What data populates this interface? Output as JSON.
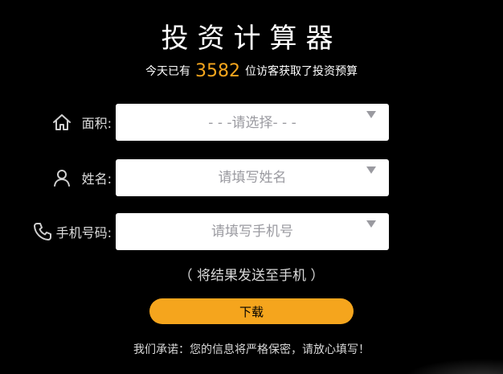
{
  "title": "投资计算器",
  "subtitle": {
    "prefix": "今天已有",
    "count": "3582",
    "suffix": "位访客获取了投资预算"
  },
  "form": {
    "area": {
      "icon": "home-icon",
      "label": "面积:",
      "selected": "- - -请选择- - -"
    },
    "name": {
      "icon": "user-icon",
      "label": "姓名:",
      "placeholder": "请填写姓名"
    },
    "phone": {
      "icon": "phone-icon",
      "label": "手机号码:",
      "placeholder": "请填写手机号"
    }
  },
  "hint": "（ 将结果发送至手机 ）",
  "download_label": "下载",
  "promise": "我们承诺：您的信息将严格保密，请放心填写！",
  "colors": {
    "background": "#000000",
    "accent": "#F5A51D",
    "field_background": "#FFFFFF",
    "placeholder": "#9A9AA0"
  }
}
